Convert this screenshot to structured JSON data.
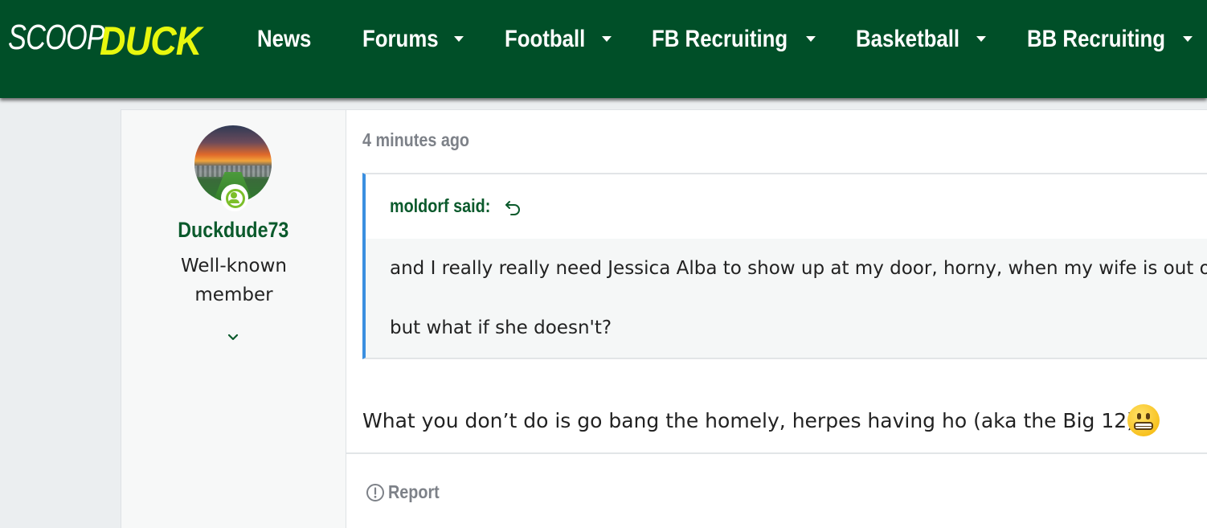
{
  "brand": {
    "logo_part1": "SCOOP",
    "logo_part2": "DUCK",
    "primary_color": "#004f28",
    "accent_color": "#e8f70e"
  },
  "nav": {
    "items": [
      {
        "label": "News",
        "has_dropdown": false
      },
      {
        "label": "Forums",
        "has_dropdown": true
      },
      {
        "label": "Football",
        "has_dropdown": true
      },
      {
        "label": "FB Recruiting",
        "has_dropdown": true
      },
      {
        "label": "Basketball",
        "has_dropdown": true
      },
      {
        "label": "BB Recruiting",
        "has_dropdown": true
      }
    ]
  },
  "post": {
    "author": {
      "username": "Duckdude73",
      "title": "Well-known member",
      "online": true,
      "avatar_icon": "stadium-sunset-avatar",
      "expand_icon": "chevron-down-icon"
    },
    "timestamp": "4 minutes ago",
    "quote": {
      "author_label": "moldorf said:",
      "jump_icon": "reply-arrow-icon",
      "lines": [
        "and I really really need Jessica Alba to show up at my door, horny, when my wife is out of",
        "but what if she doesn't?"
      ],
      "accent_color": "#3a8fe0"
    },
    "message": "What you don’t do is go bang the homely, herpes having ho (aka the Big 12)",
    "emoji": "grimacing-face-emoji",
    "actions": {
      "report_label": "Report",
      "report_icon": "exclamation-circle-icon"
    }
  }
}
